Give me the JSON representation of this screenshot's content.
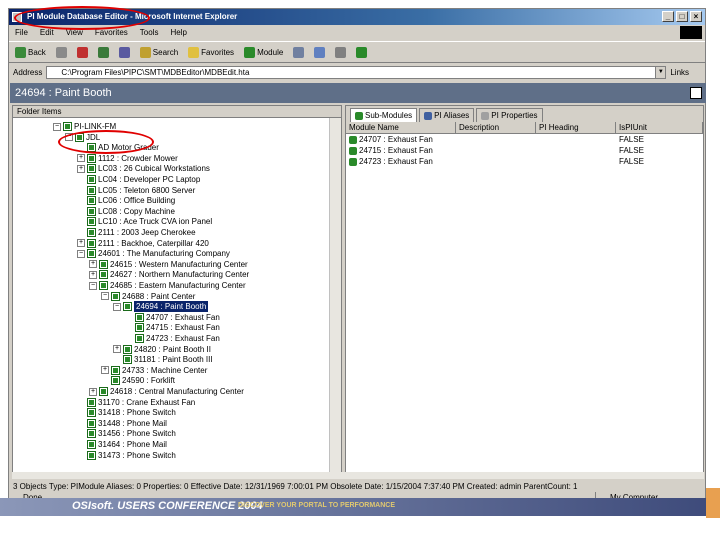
{
  "window": {
    "title": "PI Module Database Editor - Microsoft Internet Explorer"
  },
  "menu": [
    "File",
    "Edit",
    "View",
    "Favorites",
    "Tools",
    "Help"
  ],
  "toolbar": {
    "back": "Back",
    "search": "Search",
    "favorites": "Favorites",
    "module": "Module"
  },
  "address": {
    "label": "Address",
    "value": "C:\\Program Files\\PIPC\\SMT\\MDBEditor\\MDBEdit.hta",
    "links": "Links"
  },
  "header": {
    "title": "24694 : Paint Booth"
  },
  "tree": {
    "pane_label": "Folder Items",
    "nodes": [
      {
        "label": "PI-LINK-FM",
        "level": 0,
        "exp": "-"
      },
      {
        "label": "JDL",
        "level": 1,
        "exp": "-"
      },
      {
        "label": "AD  Motor Grader",
        "level": 2,
        "exp": ""
      },
      {
        "label": "1112 : Crowder Mower",
        "level": 2,
        "exp": "+"
      },
      {
        "label": "LC03 : 26 Cubical Workstations",
        "level": 2,
        "exp": "+"
      },
      {
        "label": "LC04 : Developer PC Laptop",
        "level": 2,
        "exp": ""
      },
      {
        "label": "LC05 : Teleton 6800 Server",
        "level": 2,
        "exp": ""
      },
      {
        "label": "LC06 : Office Building",
        "level": 2,
        "exp": ""
      },
      {
        "label": "LC08 : Copy Machine",
        "level": 2,
        "exp": ""
      },
      {
        "label": "LC10 : Ace Truck CVA   ion Panel",
        "level": 2,
        "exp": ""
      },
      {
        "label": "2111 : 2003 Jeep Cherokee",
        "level": 2,
        "exp": ""
      },
      {
        "label": "2111 : Backhoe, Caterpillar 420",
        "level": 2,
        "exp": "+"
      },
      {
        "label": "24601 : The Manufacturing Company",
        "level": 2,
        "exp": "-"
      },
      {
        "label": "24615 : Western Manufacturing Center",
        "level": 3,
        "exp": "+"
      },
      {
        "label": "24627 : Northern Manufacturing Center",
        "level": 3,
        "exp": "+"
      },
      {
        "label": "24685 : Eastern Manufacturing Center",
        "level": 3,
        "exp": "-"
      },
      {
        "label": "24688 : Paint Center",
        "level": 4,
        "exp": "-"
      },
      {
        "label": "24694 : Paint Booth",
        "level": 5,
        "exp": "-",
        "selected": true
      },
      {
        "label": "24707 : Exhaust Fan",
        "level": 6,
        "exp": ""
      },
      {
        "label": "24715 : Exhaust Fan",
        "level": 6,
        "exp": ""
      },
      {
        "label": "24723 : Exhaust Fan",
        "level": 6,
        "exp": ""
      },
      {
        "label": "24820 : Paint Booth II",
        "level": 5,
        "exp": "+"
      },
      {
        "label": "31181 : Paint Booth III",
        "level": 5,
        "exp": ""
      },
      {
        "label": "24733 : Machine Center",
        "level": 4,
        "exp": "+"
      },
      {
        "label": "24590 : Forklift",
        "level": 4,
        "exp": ""
      },
      {
        "label": "24618 : Central Manufacturing Center",
        "level": 3,
        "exp": "+"
      },
      {
        "label": "31170 : Crane Exhaust Fan",
        "level": 2,
        "exp": ""
      },
      {
        "label": "31418 : Phone Switch",
        "level": 2,
        "exp": ""
      },
      {
        "label": "31448 : Phone Mail",
        "level": 2,
        "exp": ""
      },
      {
        "label": "31456 : Phone Switch",
        "level": 2,
        "exp": ""
      },
      {
        "label": "31464 : Phone Mail",
        "level": 2,
        "exp": ""
      },
      {
        "label": "31473 : Phone Switch",
        "level": 2,
        "exp": ""
      }
    ]
  },
  "tabs": [
    {
      "label": "Sub-Modules",
      "active": true
    },
    {
      "label": "PI Aliases",
      "active": false
    },
    {
      "label": "PI Properties",
      "active": false
    }
  ],
  "grid": {
    "columns": [
      "Module Name",
      "Description",
      "PI Heading",
      "IsPIUnit"
    ],
    "rows": [
      [
        "24707 : Exhaust Fan",
        "",
        "",
        "FALSE"
      ],
      [
        "24715 : Exhaust Fan",
        "",
        "",
        "FALSE"
      ],
      [
        "24723 : Exhaust Fan",
        "",
        "",
        "FALSE"
      ]
    ]
  },
  "status": {
    "text": "3 Objects    Type: PIModule    Aliases: 0    Properties: 0    Effective Date: 12/31/1969 7:00:01 PM    Obsolete Date: 1/15/2004 7:37:40 PM    Created: admin    ParentCount: 1"
  },
  "iestatus": {
    "done": "Done",
    "zone": "My Computer"
  },
  "banner": {
    "brand": "OSIsoft. USERS CONFERENCE 2004",
    "tagline": "DISCOVER YOUR PORTAL TO PERFORMANCE"
  }
}
